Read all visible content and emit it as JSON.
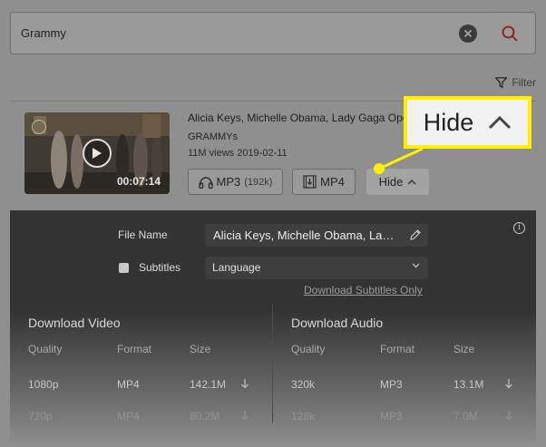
{
  "search": {
    "query": "Grammy"
  },
  "filter": {
    "label": "Filter"
  },
  "video": {
    "title": "Alicia Keys, Michelle Obama, Lady Gaga Opening",
    "channel": "GRAMMYs",
    "meta": "11M views 2019-02-11",
    "duration": "00:07:14"
  },
  "buttons": {
    "mp3_label": "MP3",
    "mp3_bitrate": "(192k)",
    "mp4_label": "MP4",
    "hide_label": "Hide"
  },
  "callout": {
    "label": "Hide",
    "color": "#ffef00"
  },
  "panel": {
    "file_name_label": "File Name",
    "file_name_value": "Alicia Keys, Michelle Obama, Lady Gaga Opening",
    "subtitles_label": "Subtitles",
    "language_value": "Language",
    "download_subs_link": "Download Subtitles Only",
    "video_section": {
      "title": "Download Video",
      "headers": [
        "Quality",
        "Format",
        "Size"
      ],
      "rows": [
        {
          "quality": "1080p",
          "format": "MP4",
          "size": "142.1M"
        },
        {
          "quality": "720p",
          "format": "MP4",
          "size": "80.2M"
        }
      ]
    },
    "audio_section": {
      "title": "Download Audio",
      "headers": [
        "Quality",
        "Format",
        "Size"
      ],
      "rows": [
        {
          "quality": "320k",
          "format": "MP3",
          "size": "13.1M"
        },
        {
          "quality": "128k",
          "format": "MP3",
          "size": "7.0M"
        }
      ]
    }
  }
}
